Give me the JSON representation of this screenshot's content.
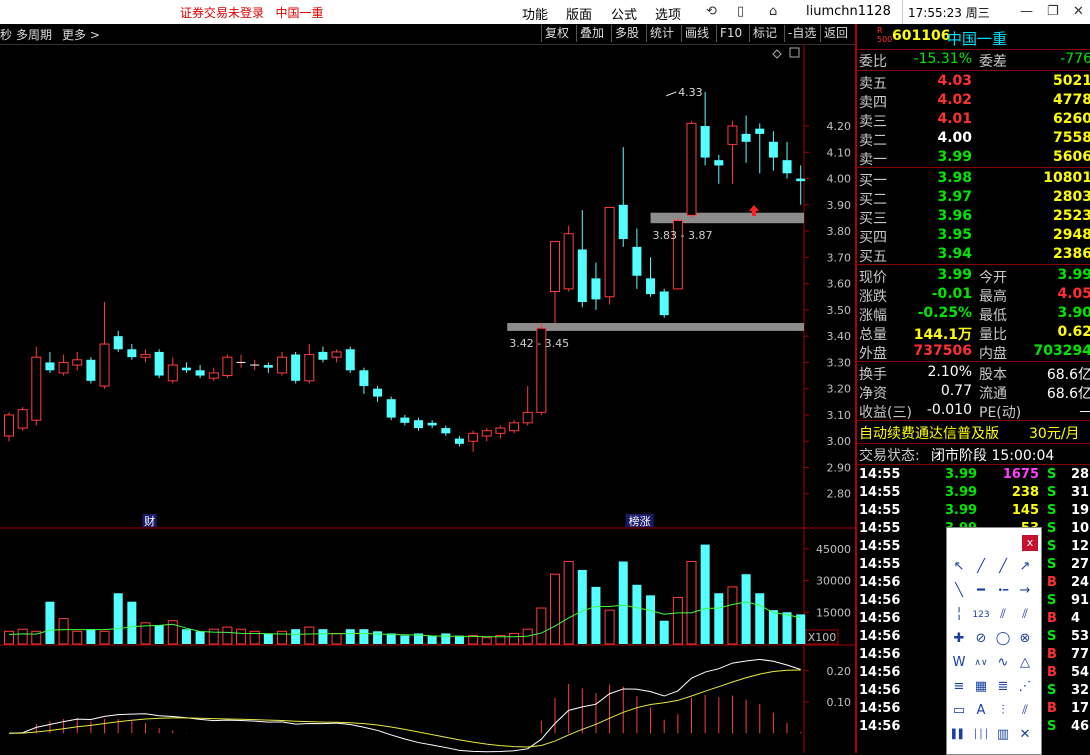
{
  "titlebar": {
    "login_warning": "证券交易未登录",
    "stock_title": "中国一重",
    "menus": [
      "功能",
      "版面",
      "公式",
      "选项"
    ],
    "user": "liumchn1128",
    "clock": "17:55:23 周三"
  },
  "toolbar": {
    "left": [
      "秒",
      "多周期",
      "更多 >"
    ],
    "buttons": [
      "复权",
      "叠加",
      "多股",
      "统计",
      "画线",
      "F10",
      "标记",
      "-自选",
      "返回"
    ]
  },
  "chart_data": {
    "type": "candlestick",
    "ylim": [
      2.8,
      4.33
    ],
    "yticks": [
      "4.20",
      "4.10",
      "4.00",
      "3.90",
      "3.80",
      "3.70",
      "3.60",
      "3.50",
      "3.40",
      "3.30",
      "3.20",
      "3.10",
      "3.00",
      "2.90",
      "2.80"
    ],
    "candles": [
      [
        3.02,
        3.1,
        3.11,
        3.0
      ],
      [
        3.05,
        3.12,
        3.13,
        3.04
      ],
      [
        3.08,
        3.32,
        3.36,
        3.06
      ],
      [
        3.3,
        3.27,
        3.34,
        3.26
      ],
      [
        3.26,
        3.3,
        3.33,
        3.25
      ],
      [
        3.29,
        3.31,
        3.34,
        3.27
      ],
      [
        3.31,
        3.23,
        3.32,
        3.22
      ],
      [
        3.21,
        3.37,
        3.53,
        3.2
      ],
      [
        3.4,
        3.35,
        3.42,
        3.34
      ],
      [
        3.35,
        3.32,
        3.37,
        3.31
      ],
      [
        3.32,
        3.33,
        3.35,
        3.3
      ],
      [
        3.34,
        3.25,
        3.35,
        3.24
      ],
      [
        3.23,
        3.29,
        3.32,
        3.22
      ],
      [
        3.28,
        3.27,
        3.3,
        3.26
      ],
      [
        3.27,
        3.25,
        3.29,
        3.24
      ],
      [
        3.24,
        3.26,
        3.28,
        3.23
      ],
      [
        3.25,
        3.32,
        3.33,
        3.24
      ],
      [
        3.3,
        3.3,
        3.33,
        3.28
      ],
      [
        3.29,
        3.29,
        3.31,
        3.27
      ],
      [
        3.29,
        3.28,
        3.3,
        3.26
      ],
      [
        3.26,
        3.32,
        3.34,
        3.25
      ],
      [
        3.33,
        3.23,
        3.34,
        3.22
      ],
      [
        3.23,
        3.33,
        3.37,
        3.22
      ],
      [
        3.34,
        3.31,
        3.36,
        3.3
      ],
      [
        3.32,
        3.34,
        3.35,
        3.3
      ],
      [
        3.35,
        3.27,
        3.36,
        3.26
      ],
      [
        3.27,
        3.21,
        3.28,
        3.18
      ],
      [
        3.2,
        3.17,
        3.21,
        3.15
      ],
      [
        3.16,
        3.09,
        3.17,
        3.08
      ],
      [
        3.09,
        3.07,
        3.1,
        3.06
      ],
      [
        3.08,
        3.05,
        3.09,
        3.04
      ],
      [
        3.07,
        3.06,
        3.08,
        3.05
      ],
      [
        3.05,
        3.03,
        3.06,
        3.02
      ],
      [
        3.01,
        2.99,
        3.02,
        2.98
      ],
      [
        3.0,
        3.03,
        3.04,
        2.96
      ],
      [
        3.02,
        3.04,
        3.05,
        3.0
      ],
      [
        3.03,
        3.05,
        3.06,
        3.01
      ],
      [
        3.04,
        3.07,
        3.08,
        3.03
      ],
      [
        3.07,
        3.11,
        3.21,
        3.06
      ],
      [
        3.11,
        3.43,
        3.45,
        3.1
      ],
      [
        3.57,
        3.76,
        3.76,
        3.45
      ],
      [
        3.58,
        3.79,
        3.82,
        3.57
      ],
      [
        3.73,
        3.53,
        3.88,
        3.51
      ],
      [
        3.62,
        3.54,
        3.68,
        3.5
      ],
      [
        3.55,
        3.89,
        3.89,
        3.52
      ],
      [
        3.9,
        3.77,
        4.12,
        3.74
      ],
      [
        3.74,
        3.63,
        3.81,
        3.58
      ],
      [
        3.62,
        3.56,
        3.7,
        3.55
      ],
      [
        3.57,
        3.48,
        3.58,
        3.47
      ],
      [
        3.58,
        3.84,
        3.85,
        3.58
      ],
      [
        3.86,
        4.21,
        4.22,
        3.85
      ],
      [
        4.2,
        4.08,
        4.33,
        4.05
      ],
      [
        4.07,
        4.05,
        4.09,
        3.98
      ],
      [
        4.13,
        4.2,
        4.22,
        3.98
      ],
      [
        4.17,
        4.14,
        4.24,
        4.06
      ],
      [
        4.19,
        4.17,
        4.21,
        4.02
      ],
      [
        4.14,
        4.08,
        4.18,
        4.03
      ],
      [
        4.07,
        4.02,
        4.14,
        4.0
      ],
      [
        4.0,
        3.99,
        4.05,
        3.9
      ]
    ],
    "zones": [
      {
        "label": "3.83 - 3.87"
      },
      {
        "label": "3.42 - 3.45"
      }
    ],
    "max_label": "4.33",
    "event_markers": [
      "财",
      "榜涨"
    ],
    "volume": {
      "yticks": [
        "45000",
        "30000",
        "15000"
      ],
      "unit": "X100",
      "values": [
        6000,
        7000,
        6000,
        20000,
        12000,
        6000,
        7000,
        6000,
        24000,
        20000,
        10000,
        9000,
        11000,
        7000,
        6000,
        7000,
        8000,
        7000,
        6000,
        5000,
        6000,
        7000,
        8000,
        7000,
        5000,
        7000,
        7000,
        6000,
        5000,
        4000,
        5000,
        4000,
        5000,
        4000,
        4000,
        3000,
        4000,
        5000,
        7000,
        17000,
        33000,
        39000,
        35000,
        27000,
        16000,
        39000,
        28000,
        23000,
        11000,
        22000,
        39000,
        47000,
        24000,
        27000,
        33000,
        24000,
        16000,
        15000,
        14000
      ]
    },
    "macd": {
      "yticks": [
        "0.20",
        "0.10"
      ]
    }
  },
  "quote": {
    "badge_top": "R",
    "badge_bottom": "500",
    "code": "601106",
    "name": "中国一重",
    "weibi_label": "委比",
    "weibi_value": "-15.31%",
    "weicha_label": "委差",
    "weicha_value": "-776",
    "asks": [
      {
        "label": "卖五",
        "price": "4.03",
        "vol": "5021"
      },
      {
        "label": "卖四",
        "price": "4.02",
        "vol": "4778"
      },
      {
        "label": "卖三",
        "price": "4.01",
        "vol": "6260"
      },
      {
        "label": "卖二",
        "price": "4.00",
        "vol": "7558"
      },
      {
        "label": "卖一",
        "price": "3.99",
        "vol": "5606"
      }
    ],
    "bids": [
      {
        "label": "买一",
        "price": "3.98",
        "vol": "10801"
      },
      {
        "label": "买二",
        "price": "3.97",
        "vol": "2803"
      },
      {
        "label": "买三",
        "price": "3.96",
        "vol": "2523"
      },
      {
        "label": "买四",
        "price": "3.95",
        "vol": "2948"
      },
      {
        "label": "买五",
        "price": "3.94",
        "vol": "2386"
      }
    ],
    "stats": [
      {
        "l1": "现价",
        "v1": "3.99",
        "l2": "今开",
        "v2": "3.99"
      },
      {
        "l1": "涨跌",
        "v1": "-0.01",
        "l2": "最高",
        "v2": "4.05"
      },
      {
        "l1": "涨幅",
        "v1": "-0.25%",
        "l2": "最低",
        "v2": "3.90"
      },
      {
        "l1": "总量",
        "v1": "144.1万",
        "l2": "量比",
        "v2": "0.62"
      },
      {
        "l1": "外盘",
        "v1": "737506",
        "l2": "内盘",
        "v2": "703294"
      }
    ],
    "fund": [
      {
        "l1": "换手",
        "v1": "2.10%",
        "l2": "股本",
        "v2": "68.6亿"
      },
      {
        "l1": "净资",
        "v1": "0.77",
        "l2": "流通",
        "v2": "68.6亿"
      },
      {
        "l1": "收益(三)",
        "v1": "-0.010",
        "l2": "PE(动)",
        "v2": "－"
      }
    ],
    "promo": "自动续费通达信普及版",
    "promo_price": "30元/月",
    "status_label": "交易状态:",
    "status_value": "闭市阶段 15:00:04",
    "ticks": [
      {
        "t": "14:55",
        "p": "3.99",
        "v": "1675",
        "bs": "S",
        "n": "28"
      },
      {
        "t": "14:55",
        "p": "3.99",
        "v": "238",
        "bs": "S",
        "n": "31"
      },
      {
        "t": "14:55",
        "p": "3.99",
        "v": "145",
        "bs": "S",
        "n": "19"
      },
      {
        "t": "14:55",
        "p": "3.99",
        "v": "53",
        "bs": "S",
        "n": "10"
      },
      {
        "t": "14:55",
        "p": "",
        "v": "",
        "bs": "S",
        "n": "12"
      },
      {
        "t": "14:55",
        "p": "",
        "v": "",
        "bs": "S",
        "n": "27"
      },
      {
        "t": "14:56",
        "p": "",
        "v": "",
        "bs": "B",
        "n": "24"
      },
      {
        "t": "14:56",
        "p": "",
        "v": "",
        "bs": "S",
        "n": "91"
      },
      {
        "t": "14:56",
        "p": "",
        "v": "",
        "bs": "B",
        "n": "4"
      },
      {
        "t": "14:56",
        "p": "",
        "v": "",
        "bs": "S",
        "n": "53"
      },
      {
        "t": "14:56",
        "p": "",
        "v": "",
        "bs": "B",
        "n": "77"
      },
      {
        "t": "14:56",
        "p": "",
        "v": "",
        "bs": "B",
        "n": "54"
      },
      {
        "t": "14:56",
        "p": "",
        "v": "",
        "bs": "S",
        "n": "32"
      },
      {
        "t": "14:56",
        "p": "",
        "v": "",
        "bs": "B",
        "n": "17"
      },
      {
        "t": "14:56",
        "p": "",
        "v": "",
        "bs": "S",
        "n": "46"
      }
    ]
  },
  "palette": {
    "close": "x",
    "tools": [
      "cursor-tool",
      "line-tool",
      "ray-tool",
      "arrow-line-tool",
      "segment-tool",
      "hline-tool",
      "ray-hline-tool",
      "arrow-tool",
      "vline-tool",
      "price-label-tool",
      "parallel-tool",
      "channel-tool",
      "cross-tool",
      "time-cycle-tool",
      "circle-tool",
      "fan-tool",
      "wave-tool",
      "zigzag-tool",
      "elliott-tool",
      "triangle-tool",
      "fib-tool",
      "gann-square-tool",
      "gann-angle-tool",
      "speed-tool",
      "rect-tool",
      "text-tool",
      "fib-fan-tool",
      "fib-arc-tool",
      "bar-tool",
      "period-tool",
      "golden-tool",
      "delete-tool"
    ]
  }
}
